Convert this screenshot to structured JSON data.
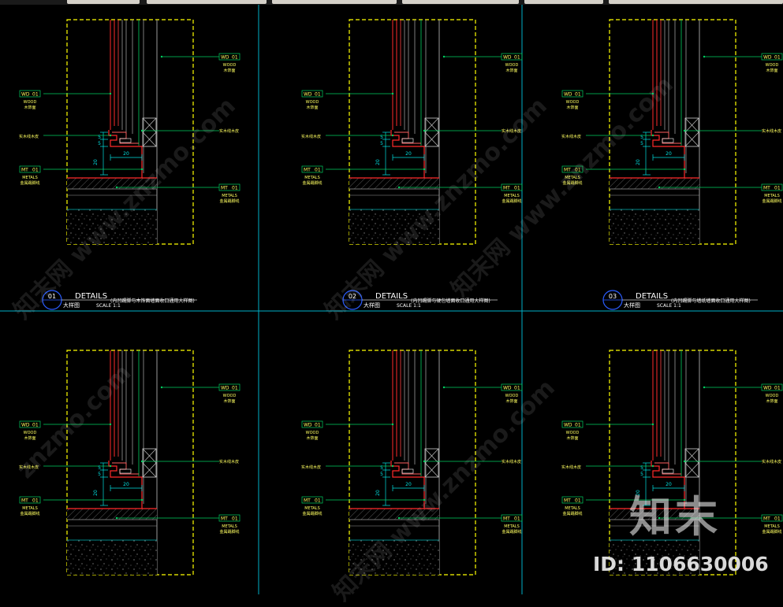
{
  "colors": {
    "frame": "#ffff00",
    "red": "#ff2a2a",
    "wall": "#9a9a9a",
    "green": "#00d060",
    "blue": "#2a5cff",
    "dim": "#00e0e0",
    "text": "#ffff60",
    "grid": "#00b0c8"
  },
  "labels": {
    "wood_top": {
      "code": "WD",
      "num": "01",
      "sub": "WOOD",
      "cn": "木饰面"
    },
    "wood_left": {
      "code": "WD",
      "num": "01",
      "sub": "WOOD",
      "cn": "木饰面"
    },
    "trim": {
      "cn": "实木线木皮"
    },
    "metal_left": {
      "code": "MT",
      "num": "01",
      "sub": "METALS",
      "cn": "金属踢脚线"
    },
    "metal_right": {
      "code": "MT",
      "num": "01",
      "sub": "METALS",
      "cn": "金属踢脚线"
    }
  },
  "dims": {
    "a": "5",
    "b": "5",
    "c": "20",
    "d": "20"
  },
  "details": [
    {
      "num": "01",
      "title": "DETAILS",
      "sub": "大样图",
      "scale": "SCALE 1:1",
      "desc": "(内凹踢脚与木饰面墙面收口通用大样图)"
    },
    {
      "num": "02",
      "title": "DETAILS",
      "sub": "大样图",
      "scale": "SCALE 1:1",
      "desc": "(内凹踢脚与硬包墙面收口通用大样图)"
    },
    {
      "num": "03",
      "title": "DETAILS",
      "sub": "大样图",
      "scale": "SCALE 1:1",
      "desc": "(内凹踢脚与墙纸墙面收口通用大样图)"
    }
  ],
  "watermark": {
    "text": "znzmo.com",
    "site": "知末网 www.znzmo.com"
  },
  "brand": {
    "name": "知末",
    "id": "ID: 1106630006"
  }
}
